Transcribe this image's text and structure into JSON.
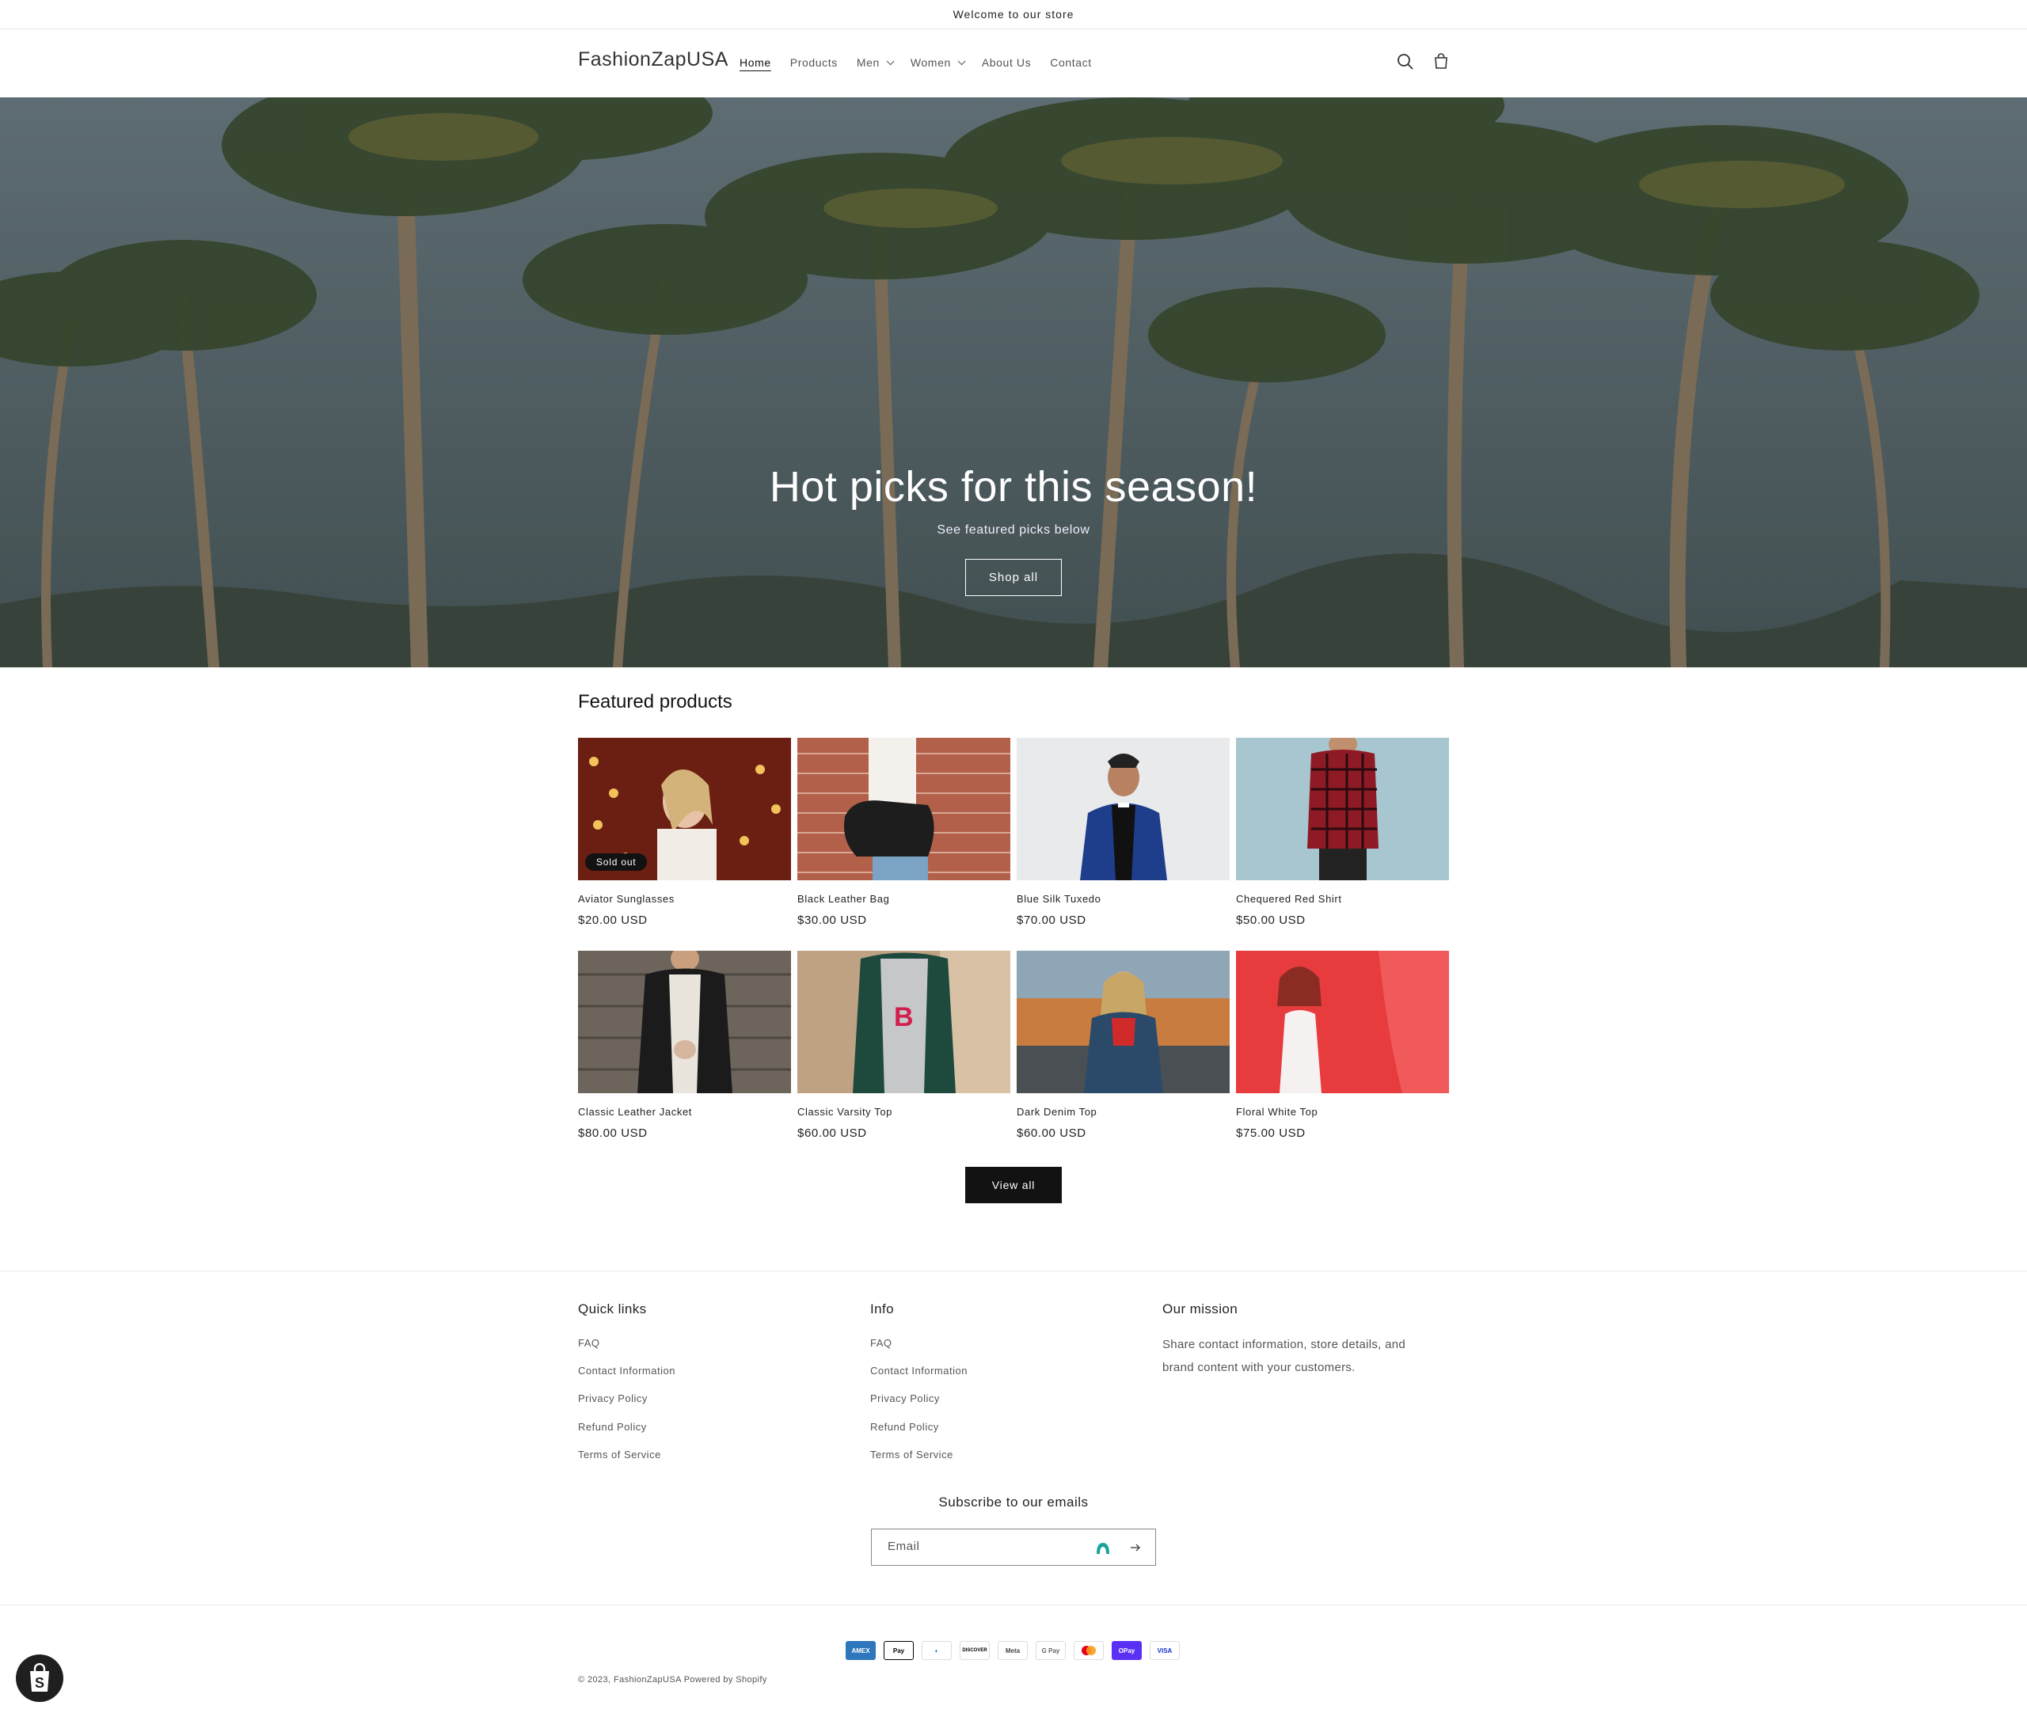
{
  "announcement": "Welcome to our store",
  "header": {
    "logo": "FashionZapUSA",
    "nav": [
      {
        "label": "Home",
        "active": true,
        "dropdown": false
      },
      {
        "label": "Products",
        "active": false,
        "dropdown": false
      },
      {
        "label": "Men",
        "active": false,
        "dropdown": true
      },
      {
        "label": "Women",
        "active": false,
        "dropdown": true
      },
      {
        "label": "About Us",
        "active": false,
        "dropdown": false
      },
      {
        "label": "Contact",
        "active": false,
        "dropdown": false
      }
    ],
    "icons": [
      "search-icon",
      "cart-icon"
    ]
  },
  "hero": {
    "title": "Hot picks for this season!",
    "subtitle": "See featured picks below",
    "button": "Shop all"
  },
  "featured": {
    "heading": "Featured products",
    "products": [
      {
        "name": "Aviator Sunglasses",
        "price": "$20.00 USD",
        "badge": "Sold out"
      },
      {
        "name": "Black Leather Bag",
        "price": "$30.00 USD"
      },
      {
        "name": "Blue Silk Tuxedo",
        "price": "$70.00 USD"
      },
      {
        "name": "Chequered Red Shirt",
        "price": "$50.00 USD"
      },
      {
        "name": "Classic Leather Jacket",
        "price": "$80.00 USD"
      },
      {
        "name": "Classic Varsity Top",
        "price": "$60.00 USD"
      },
      {
        "name": "Dark Denim Top",
        "price": "$60.00 USD"
      },
      {
        "name": "Floral White Top",
        "price": "$75.00 USD"
      }
    ],
    "view_all": "View all"
  },
  "footer": {
    "quick_links": {
      "heading": "Quick links",
      "links": [
        "FAQ",
        "Contact Information",
        "Privacy Policy",
        "Refund Policy",
        "Terms of Service"
      ]
    },
    "info": {
      "heading": "Info",
      "links": [
        "FAQ",
        "Contact Information",
        "Privacy Policy",
        "Refund Policy",
        "Terms of Service"
      ]
    },
    "mission": {
      "heading": "Our mission",
      "text": "Share contact information, store details, and brand content with your customers."
    },
    "subscribe": {
      "heading": "Subscribe to our emails",
      "placeholder": "Email"
    },
    "payments": [
      "AMEX",
      "Pay",
      "Diners",
      "DISCOVER",
      "Meta",
      "G Pay",
      "Mastercard",
      "OPay",
      "VISA"
    ],
    "copyright": "© 2023, FashionZapUSA Powered by Shopify"
  },
  "colors": {
    "accent": "#121212",
    "hero_overlay": "#55666b",
    "sold_out_badge": "#121212"
  }
}
